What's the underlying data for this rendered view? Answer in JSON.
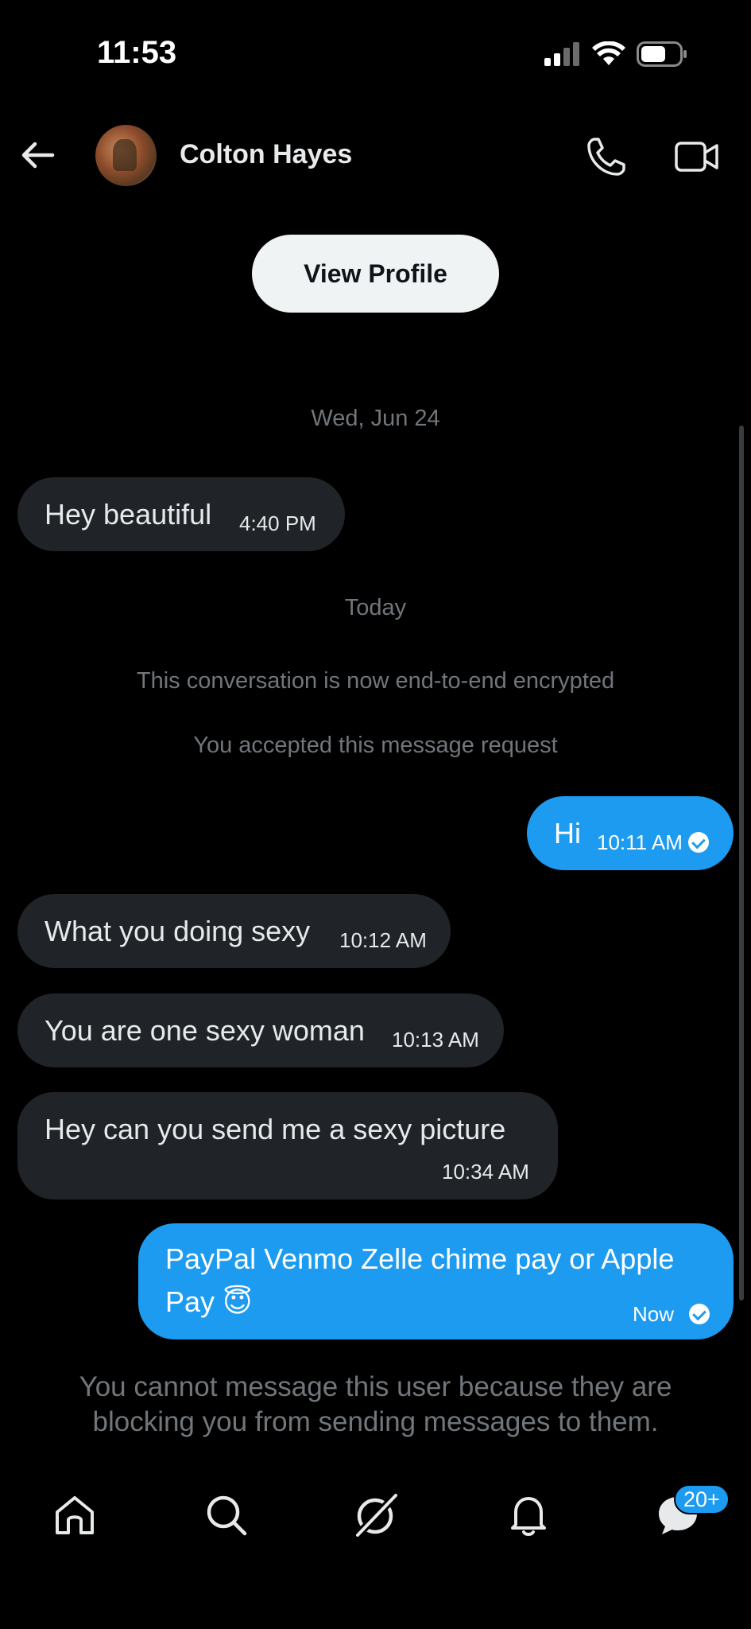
{
  "status_bar": {
    "time": "11:53"
  },
  "header": {
    "contact_name": "Colton Hayes"
  },
  "profile_button": {
    "label": "View Profile"
  },
  "conversation": {
    "date_old": "Wed, Jun 24",
    "date_today": "Today",
    "encrypted_notice": "This conversation is now end-to-end encrypted",
    "accepted_notice": "You accepted this message request",
    "messages": [
      {
        "direction": "incoming",
        "text": "Hey beautiful",
        "time": "4:40 PM"
      },
      {
        "direction": "outgoing",
        "text": "Hi",
        "time": "10:11 AM"
      },
      {
        "direction": "incoming",
        "text": "What you doing sexy",
        "time": "10:12 AM"
      },
      {
        "direction": "incoming",
        "text": "You are one sexy woman",
        "time": "10:13 AM"
      },
      {
        "direction": "incoming",
        "text": "Hey can you send me a sexy picture",
        "time": "10:34 AM"
      },
      {
        "direction": "outgoing",
        "text_line1": "PayPal Venmo Zelle chime pay or Apple",
        "text_line2": "Pay 😇",
        "time": "Now"
      }
    ]
  },
  "blocked_notice": {
    "line1": "You cannot message this user because they are",
    "line2": "blocking you from sending messages to them."
  },
  "bottom_nav": {
    "items": [
      "home-icon",
      "search-icon",
      "grok-icon",
      "notifications-icon",
      "messages-icon"
    ],
    "messages_badge": "20+"
  },
  "colors": {
    "accent": "#1d9bf0",
    "incoming_bubble": "#202327",
    "background": "#000000",
    "muted": "#71767b"
  }
}
